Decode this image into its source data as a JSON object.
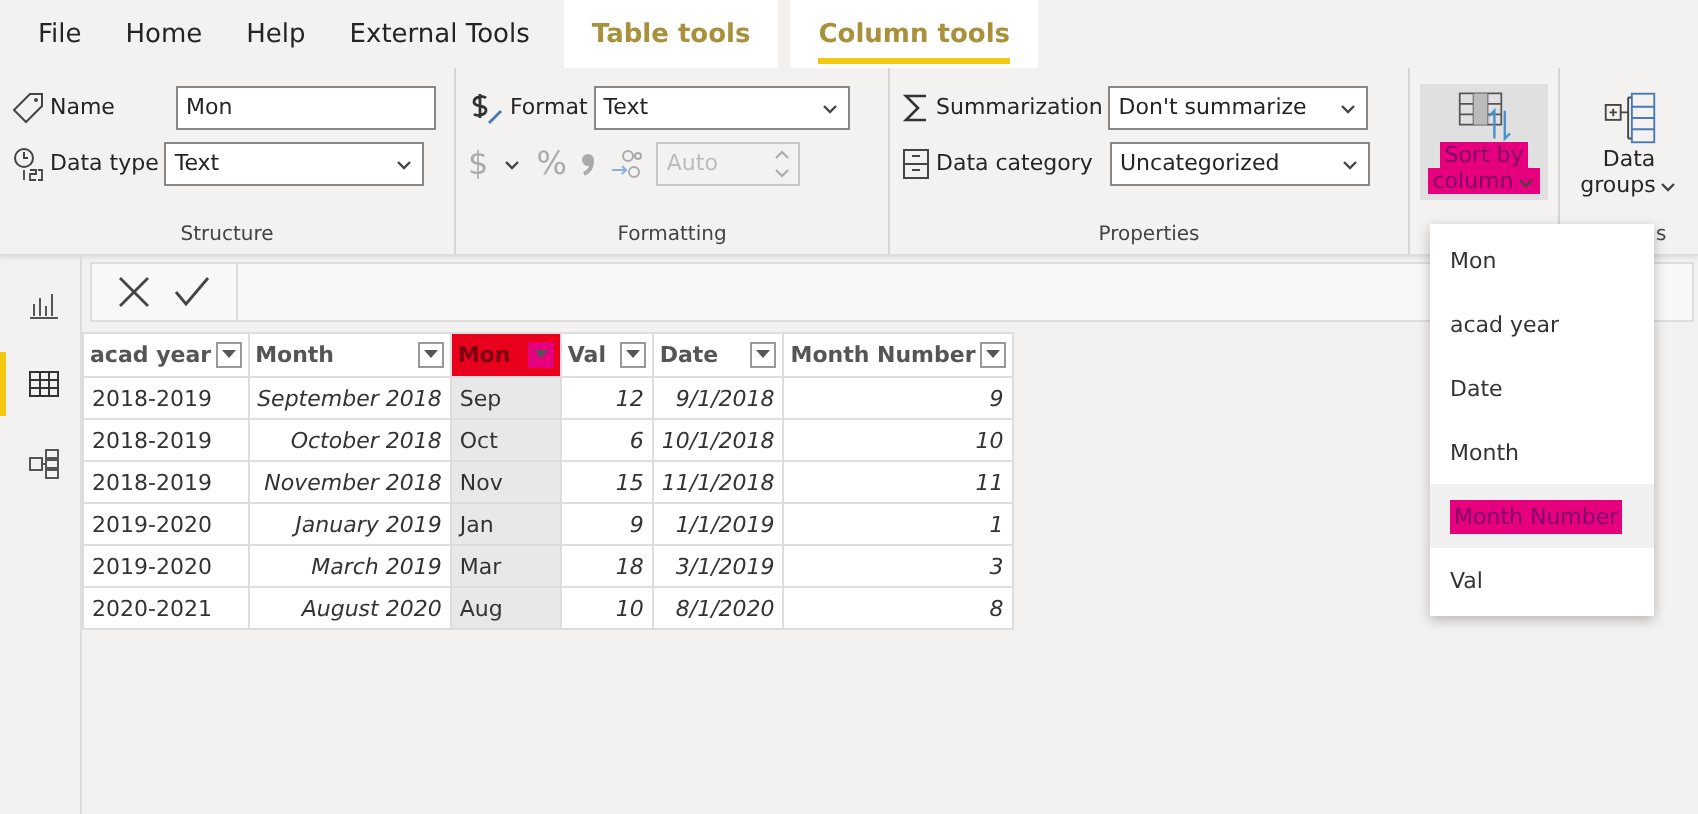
{
  "ribbon_tabs": [
    {
      "label": "File",
      "kind": "plain",
      "selected": false
    },
    {
      "label": "Home",
      "kind": "plain",
      "selected": false
    },
    {
      "label": "Help",
      "kind": "plain",
      "selected": false
    },
    {
      "label": "External Tools",
      "kind": "plain",
      "selected": false
    },
    {
      "label": "Table tools",
      "kind": "context",
      "selected": false
    },
    {
      "label": "Column tools",
      "kind": "context",
      "selected": true
    }
  ],
  "structure": {
    "label": "Structure",
    "name_label": "Name",
    "name_value": "Mon",
    "type_label": "Data type",
    "type_value": "Text"
  },
  "formatting": {
    "label": "Formatting",
    "format_label": "Format",
    "format_value": "Text",
    "currency": "$",
    "percent": "%",
    "decimals_value": "Auto",
    "decimals_disabled": true
  },
  "properties": {
    "label": "Properties",
    "summarization_label": "Summarization",
    "summarization_value": "Don't summarize",
    "category_label": "Data category",
    "category_value": "Uncategorized"
  },
  "sort_button": {
    "line1": "Sort by",
    "line2": "column",
    "highlighted": true
  },
  "data_groups": {
    "line1": "Data",
    "line2": "groups",
    "group_label_visible": "s"
  },
  "sidebar": [
    {
      "kind": "report",
      "selected": false
    },
    {
      "kind": "data",
      "selected": true
    },
    {
      "kind": "model",
      "selected": false
    }
  ],
  "table": {
    "columns": [
      {
        "name": "acad year",
        "kind": "text",
        "highlighted": false
      },
      {
        "name": "Month",
        "kind": "value",
        "highlighted": false
      },
      {
        "name": "Mon",
        "kind": "text",
        "highlighted": true
      },
      {
        "name": "Val",
        "kind": "value",
        "highlighted": false
      },
      {
        "name": "Date",
        "kind": "value",
        "highlighted": false
      },
      {
        "name": "Month Number",
        "kind": "value",
        "highlighted": false
      }
    ],
    "rows": [
      [
        "2018-2019",
        "September 2018",
        "Sep",
        "12",
        "9/1/2018",
        "9"
      ],
      [
        "2018-2019",
        "October 2018",
        "Oct",
        "6",
        "10/1/2018",
        "10"
      ],
      [
        "2018-2019",
        "November 2018",
        "Nov",
        "15",
        "11/1/2018",
        "11"
      ],
      [
        "2019-2020",
        "January 2019",
        "Jan",
        "9",
        "1/1/2019",
        "1"
      ],
      [
        "2019-2020",
        "March 2019",
        "Mar",
        "18",
        "3/1/2019",
        "3"
      ],
      [
        "2020-2021",
        "August 2020",
        "Aug",
        "10",
        "8/1/2020",
        "8"
      ]
    ]
  },
  "sort_menu": [
    {
      "label": "Mon",
      "highlighted": false
    },
    {
      "label": "acad year",
      "highlighted": false
    },
    {
      "label": "Date",
      "highlighted": false
    },
    {
      "label": "Month",
      "highlighted": false
    },
    {
      "label": "Month Number",
      "highlighted": true
    },
    {
      "label": "Val",
      "highlighted": false
    }
  ]
}
